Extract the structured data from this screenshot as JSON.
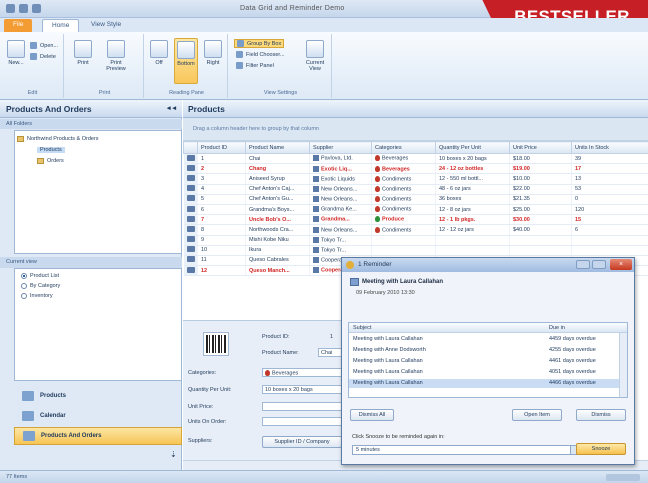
{
  "window": {
    "title": "Data Grid and Reminder Demo"
  },
  "badge": {
    "strong": "BEST",
    "rest": " SELLER"
  },
  "ribbon_tabs": [
    {
      "label": "File"
    },
    {
      "label": "Home"
    },
    {
      "label": "View Style"
    }
  ],
  "ribbon": {
    "groups": [
      {
        "label": "Edit"
      },
      {
        "label": "Print"
      },
      {
        "label": "Reading Pane"
      },
      {
        "label": "View Settings"
      }
    ],
    "buttons": {
      "new": "New...",
      "delete": "Delete",
      "open": "Open...",
      "print": "Print",
      "print_preview": "Print Preview",
      "off": "Off",
      "bottom": "Bottom",
      "right": "Right",
      "group_by_box": "Group By Box",
      "field_chooser": "Field Chooser...",
      "filter_panel": "Filter Panel",
      "current_view": "Current View"
    }
  },
  "nav": {
    "title": "Products And Orders",
    "folders_label": "All Folders",
    "tree": {
      "root": "Northwind Products & Orders",
      "products": "Products",
      "orders": "Orders"
    },
    "current_view_label": "Current view",
    "views": [
      {
        "label": "Product List",
        "selected": true
      },
      {
        "label": "By Category",
        "selected": false
      },
      {
        "label": "Inventory",
        "selected": false
      }
    ],
    "bottom_buttons": [
      {
        "label": "Products",
        "selected": false
      },
      {
        "label": "Calendar",
        "selected": false
      },
      {
        "label": "Products And Orders",
        "selected": true
      }
    ]
  },
  "main": {
    "title": "Products",
    "group_hint": "Drag a column header here to group by that column",
    "columns": [
      "",
      "Product ID",
      "Product Name",
      "Supplier",
      "Categories",
      "Quantity Per Unit",
      "Unit Price",
      "Units In Stock"
    ],
    "rows": [
      {
        "id": "1",
        "name": "Chai",
        "supplier": "Pavlova, Ltd.",
        "category": "Beverages",
        "qty": "10 boxes x 20 bags",
        "price": "$18.00",
        "stock": "39",
        "red": false,
        "cat_green": false
      },
      {
        "id": "2",
        "name": "Chang",
        "supplier": "Exotic Liq...",
        "category": "Beverages",
        "qty": "24 - 12 oz bottles",
        "price": "$19.00",
        "stock": "17",
        "red": true,
        "cat_green": false
      },
      {
        "id": "3",
        "name": "Aniseed Syrup",
        "supplier": "Exotic Liquids",
        "category": "Condiments",
        "qty": "12 - 550 ml bottl...",
        "price": "$10.00",
        "stock": "13",
        "red": false,
        "cat_green": false
      },
      {
        "id": "4",
        "name": "Chef Anton's Caj...",
        "supplier": "New Orleans...",
        "category": "Condiments",
        "qty": "48 - 6 oz jars",
        "price": "$22.00",
        "stock": "53",
        "red": false,
        "cat_green": false
      },
      {
        "id": "5",
        "name": "Chef Anton's Gu...",
        "supplier": "New Orleans...",
        "category": "Condiments",
        "qty": "36 boxes",
        "price": "$21.35",
        "stock": "0",
        "red": false,
        "cat_green": false
      },
      {
        "id": "6",
        "name": "Grandma's Boys...",
        "supplier": "Grandma Ke...",
        "category": "Condiments",
        "qty": "12 - 8 oz jars",
        "price": "$25.00",
        "stock": "120",
        "red": false,
        "cat_green": false
      },
      {
        "id": "7",
        "name": "Uncle Bob's O...",
        "supplier": "Grandma...",
        "category": "Produce",
        "qty": "12 - 1 lb pkgs.",
        "price": "$30.00",
        "stock": "15",
        "red": true,
        "cat_green": true
      },
      {
        "id": "8",
        "name": "Northwoods Cra...",
        "supplier": "New Orleans...",
        "category": "Condiments",
        "qty": "12 - 12 oz jars",
        "price": "$40.00",
        "stock": "6",
        "red": false,
        "cat_green": false
      },
      {
        "id": "9",
        "name": "Mishi Kobe Niku",
        "supplier": "Tokyo Tr...",
        "category": "",
        "qty": "",
        "price": "",
        "stock": "",
        "red": false,
        "cat_green": false
      },
      {
        "id": "10",
        "name": "Ikura",
        "supplier": "Tokyo Tr...",
        "category": "",
        "qty": "",
        "price": "",
        "stock": "",
        "red": false,
        "cat_green": false
      },
      {
        "id": "11",
        "name": "Queso Cabrales",
        "supplier": "Cooperativa...",
        "category": "",
        "qty": "",
        "price": "",
        "stock": "",
        "red": false,
        "cat_green": false
      },
      {
        "id": "12",
        "name": "Queso Manch...",
        "supplier": "Cooperativa...",
        "category": "",
        "qty": "",
        "price": "",
        "stock": "",
        "red": true,
        "cat_green": false
      }
    ]
  },
  "detail": {
    "product_id_label": "Product ID:",
    "product_id_value": "1",
    "product_name_label": "Product Name:",
    "product_name_value": "Chai",
    "categories_label": "Categories:",
    "categories_value": "Beverages",
    "qty_label": "Quantity Per Unit:",
    "qty_value": "10 boxes x 20 bags",
    "unit_price_label": "Unit Price:",
    "units_on_order_label": "Units On Order:",
    "suppliers_label": "Suppliers:",
    "supplier_button": "Supplier ID / Company"
  },
  "reminder": {
    "title": "1 Reminder",
    "meeting": "Meeting with Laura Callahan",
    "when": "09 February 2010 13:30",
    "list_headers": {
      "subject": "Subject",
      "due": "Due in"
    },
    "items": [
      {
        "subject": "Meeting with Laura Callahan",
        "due": "4459 days overdue",
        "selected": false
      },
      {
        "subject": "Meeting with Anne Dodsworth",
        "due": "4255 days overdue",
        "selected": false
      },
      {
        "subject": "Meeting with Laura Callahan",
        "due": "4461 days overdue",
        "selected": false
      },
      {
        "subject": "Meeting with Laura Callahan",
        "due": "4051 days overdue",
        "selected": false
      },
      {
        "subject": "Meeting with Laura Callahan",
        "due": "4466 days overdue",
        "selected": true
      }
    ],
    "dismiss_all": "Dismiss All",
    "open_item": "Open Item",
    "dismiss": "Dismiss",
    "hint": "Click Snooze to be reminded again in:",
    "snooze_value": "5 minutes",
    "snooze": "Snooze"
  },
  "status": {
    "text": "77 Items"
  },
  "colors": {
    "accent": "#f39c33",
    "badge": "#c62026",
    "selection": "#f7c556",
    "overdue_red": "#d12626"
  }
}
